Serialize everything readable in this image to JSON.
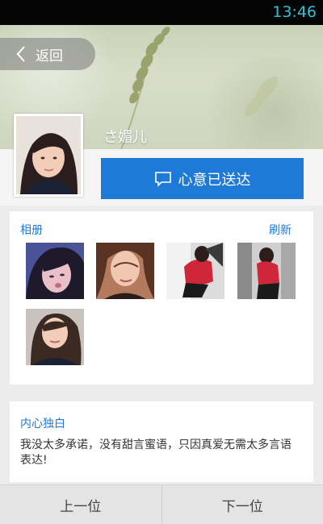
{
  "status_bar": {
    "time": "13:46"
  },
  "header": {
    "back_label": "返回",
    "nickname": "さ媚儿"
  },
  "action": {
    "heart_label": "心意已送达"
  },
  "album": {
    "label": "相册",
    "refresh_label": "刷新",
    "photo_count": 5
  },
  "bio": {
    "label": "内心独白",
    "text": "我没太多承诺，没有甜言蜜语，只因真爱无需太多言语表达!"
  },
  "bottom_nav": {
    "prev_label": "上一位",
    "next_label": "下一位"
  },
  "colors": {
    "accent": "#1e7ad6",
    "status_time": "#27c4d8"
  }
}
